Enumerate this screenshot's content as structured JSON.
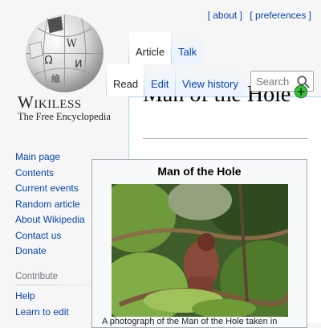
{
  "site": {
    "wordmark": "Wikiless",
    "tagline": "The Free Encyclopedia",
    "globe_glyphs": [
      "Ω",
      "W",
      "И",
      "維"
    ]
  },
  "personal_links": [
    "[ about ]",
    "[ preferences ]"
  ],
  "tabs": {
    "article": "Article",
    "talk": "Talk",
    "read": "Read",
    "edit": "Edit",
    "history": "View history"
  },
  "search": {
    "placeholder": "Search"
  },
  "nav_main": [
    "Main page",
    "Contents",
    "Current events",
    "Random article",
    "About Wikipedia",
    "Contact us",
    "Donate"
  ],
  "nav_contribute": {
    "heading": "Contribute",
    "items": [
      "Help",
      "Learn to edit"
    ]
  },
  "article": {
    "title": "Man of the Hole"
  },
  "infobox": {
    "title": "Man of the Hole",
    "caption": "A photograph of the Man of the Hole taken in"
  },
  "colors": {
    "link": "#0645ad",
    "background": "#f6f6f6",
    "tab_border": "#a7d7f9",
    "add_icon": "#2aa32a"
  }
}
